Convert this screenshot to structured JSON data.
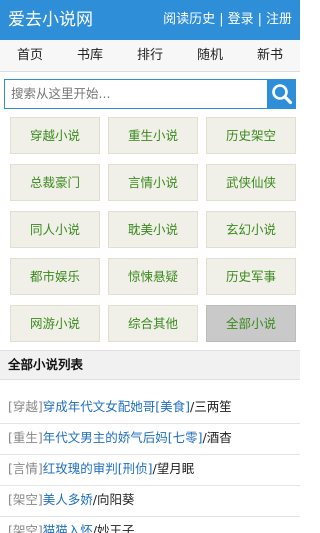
{
  "header": {
    "site_title": "爱去小说网",
    "links": [
      "阅读历史",
      "登录",
      "注册"
    ],
    "separator": "|"
  },
  "nav": {
    "items": [
      "首页",
      "书库",
      "排行",
      "随机",
      "新书"
    ]
  },
  "search": {
    "placeholder": "搜索从这里开始...",
    "button_icon": "search-icon"
  },
  "categories": [
    {
      "label": "穿越小说"
    },
    {
      "label": "重生小说"
    },
    {
      "label": "历史架空"
    },
    {
      "label": "总裁豪门"
    },
    {
      "label": "言情小说"
    },
    {
      "label": "武侠仙侠"
    },
    {
      "label": "同人小说"
    },
    {
      "label": "耽美小说"
    },
    {
      "label": "玄幻小说"
    },
    {
      "label": "都市娱乐"
    },
    {
      "label": "惊悚悬疑"
    },
    {
      "label": "历史军事"
    },
    {
      "label": "网游小说"
    },
    {
      "label": "综合其他"
    },
    {
      "label": "全部小说",
      "selected": true
    }
  ],
  "list": {
    "heading": "全部小说列表",
    "rows": [
      {
        "tag": "[穿越]",
        "title": "穿成年代文女配她哥[美食]",
        "author": "三两笙"
      },
      {
        "tag": "[重生]",
        "title": "年代文男主的娇气后妈[七零]",
        "author": "酒杳"
      },
      {
        "tag": "[言情]",
        "title": "红玫瑰的审判[刑侦]",
        "author": "望月眠"
      },
      {
        "tag": "[架空]",
        "title": "美人多娇",
        "author": "向阳葵"
      },
      {
        "tag": "[架空]",
        "title": "猫猫入怀",
        "author": "妙王子"
      }
    ]
  },
  "colors": {
    "header_bg": "#2e8ed8",
    "category_text": "#3a8a1e",
    "link_blue": "#1f6fbf"
  }
}
